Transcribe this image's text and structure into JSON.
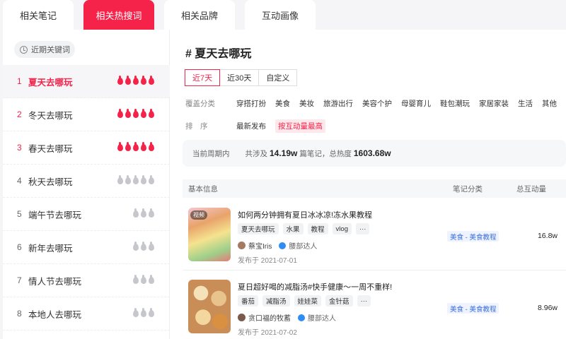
{
  "tabs": [
    {
      "label": "相关笔记",
      "active": false
    },
    {
      "label": "相关热搜词",
      "active": true
    },
    {
      "label": "相关品牌",
      "active": false
    },
    {
      "label": "互动画像",
      "active": false
    }
  ],
  "sidebar": {
    "recent_label": "近期关键词",
    "keywords": [
      {
        "rank": "1",
        "text": "夏天去哪玩",
        "heat": 5
      },
      {
        "rank": "2",
        "text": "冬天去哪玩",
        "heat": 5
      },
      {
        "rank": "3",
        "text": "春天去哪玩",
        "heat": 5
      },
      {
        "rank": "4",
        "text": "秋天去哪玩",
        "heat": 0
      },
      {
        "rank": "5",
        "text": "端午节去哪玩",
        "heat": 0
      },
      {
        "rank": "6",
        "text": "新年去哪玩",
        "heat": 0
      },
      {
        "rank": "7",
        "text": "情人节去哪玩",
        "heat": 0
      },
      {
        "rank": "8",
        "text": "本地人去哪玩",
        "heat": 0
      }
    ]
  },
  "main": {
    "title": "# 夏天去哪玩",
    "periods": [
      "近7天",
      "近30天",
      "自定义"
    ],
    "category_label": "覆盖分类",
    "categories": [
      "穿搭打扮",
      "美食",
      "美妆",
      "旅游出行",
      "美容个护",
      "母婴育儿",
      "鞋包潮玩",
      "家居家装",
      "生活",
      "其他"
    ],
    "sort_label": "排　序",
    "sort_options": [
      "最新发布",
      "按互动量最高"
    ],
    "summary": {
      "period": "当前周期内",
      "prefix": "共涉及",
      "notes": "14.19w",
      "mid": "篇笔记，总热度",
      "heat": "1603.68w"
    },
    "table": {
      "col_info": "基本信息",
      "col_category": "笔记分类",
      "col_interaction": "总互动量",
      "rows": [
        {
          "badge": "视频",
          "title": "如何两分钟拥有夏日冰冰凉!冻水果教程",
          "tags": [
            "夏天去哪玩",
            "水果",
            "教程",
            "vlog",
            "···"
          ],
          "author": "蔡宝Iris",
          "level": "腰部达人",
          "date": "发布于 2021-07-01",
          "category": "美食 - 美食教程",
          "interaction": "16.8w"
        },
        {
          "badge": "",
          "title": "夏日超好喝的减脂汤#快手健康～一周不重样!",
          "tags": [
            "番茄",
            "减脂汤",
            "娃娃菜",
            "金针菇",
            "···"
          ],
          "author": "贪口福的牧蓄",
          "level": "腰部达人",
          "date": "发布于 2021-07-02",
          "category": "美食 - 美食教程",
          "interaction": "8.96w"
        }
      ]
    }
  }
}
